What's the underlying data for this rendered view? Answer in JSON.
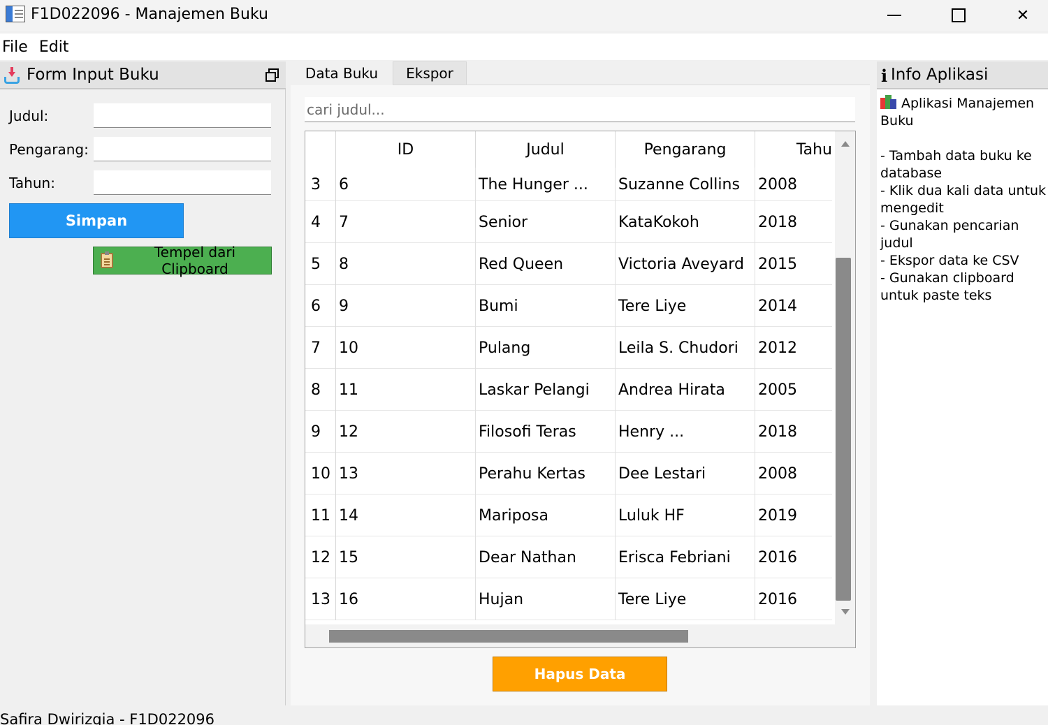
{
  "window": {
    "title": "F1D022096 - Manajemen Buku",
    "minimize_glyph": "—",
    "close_glyph": "✕"
  },
  "menu": [
    "File",
    "Edit"
  ],
  "form_dock": {
    "title": "Form Input Buku",
    "labels": {
      "judul": "Judul:",
      "pengarang": "Pengarang:",
      "tahun": "Tahun:"
    },
    "values": {
      "judul": "",
      "pengarang": "",
      "tahun": ""
    },
    "save_button": "Simpan",
    "paste_button": "Tempel dari Clipboard"
  },
  "tabs": [
    "Data Buku",
    "Ekspor"
  ],
  "search": {
    "placeholder": "cari judul...",
    "value": ""
  },
  "table": {
    "columns": [
      "ID",
      "Judul",
      "Pengarang",
      "Tahu"
    ],
    "rows": [
      {
        "num": "3",
        "id": "6",
        "judul": "The Hunger ...",
        "pengarang": "Suzanne Collins",
        "tahun": "2008"
      },
      {
        "num": "4",
        "id": "7",
        "judul": "Senior",
        "pengarang": "KataKokoh",
        "tahun": "2018"
      },
      {
        "num": "5",
        "id": "8",
        "judul": "Red Queen",
        "pengarang": "Victoria Aveyard",
        "tahun": "2015"
      },
      {
        "num": "6",
        "id": "9",
        "judul": "Bumi",
        "pengarang": "Tere Liye",
        "tahun": "2014"
      },
      {
        "num": "7",
        "id": "10",
        "judul": "Pulang",
        "pengarang": "Leila S. Chudori",
        "tahun": "2012"
      },
      {
        "num": "8",
        "id": "11",
        "judul": "Laskar Pelangi",
        "pengarang": "Andrea Hirata",
        "tahun": "2005"
      },
      {
        "num": "9",
        "id": "12",
        "judul": "Filosofi Teras",
        "pengarang": "Henry ...",
        "tahun": "2018"
      },
      {
        "num": "10",
        "id": "13",
        "judul": "Perahu Kertas",
        "pengarang": "Dee Lestari",
        "tahun": "2008"
      },
      {
        "num": "11",
        "id": "14",
        "judul": "Mariposa",
        "pengarang": "Luluk HF",
        "tahun": "2019"
      },
      {
        "num": "12",
        "id": "15",
        "judul": "Dear Nathan",
        "pengarang": "Erisca Febriani",
        "tahun": "2016"
      },
      {
        "num": "13",
        "id": "16",
        "judul": "Hujan",
        "pengarang": "Tere Liye",
        "tahun": "2016"
      }
    ]
  },
  "delete_button": "Hapus Data",
  "info_dock": {
    "icon": "i",
    "title": "Info Aplikasi",
    "app_name": "Aplikasi Manajemen Buku",
    "items": [
      "- Tambah data buku ke database",
      "- Klik dua kali data untuk mengedit",
      "- Gunakan pencarian judul",
      "- Ekspor data ke CSV",
      "- Gunakan clipboard untuk paste teks"
    ]
  },
  "status": "Safira Dwirizqia - F1D022096",
  "colors": {
    "save": "#2196f3",
    "paste": "#4caf50",
    "delete": "#ffa000"
  }
}
